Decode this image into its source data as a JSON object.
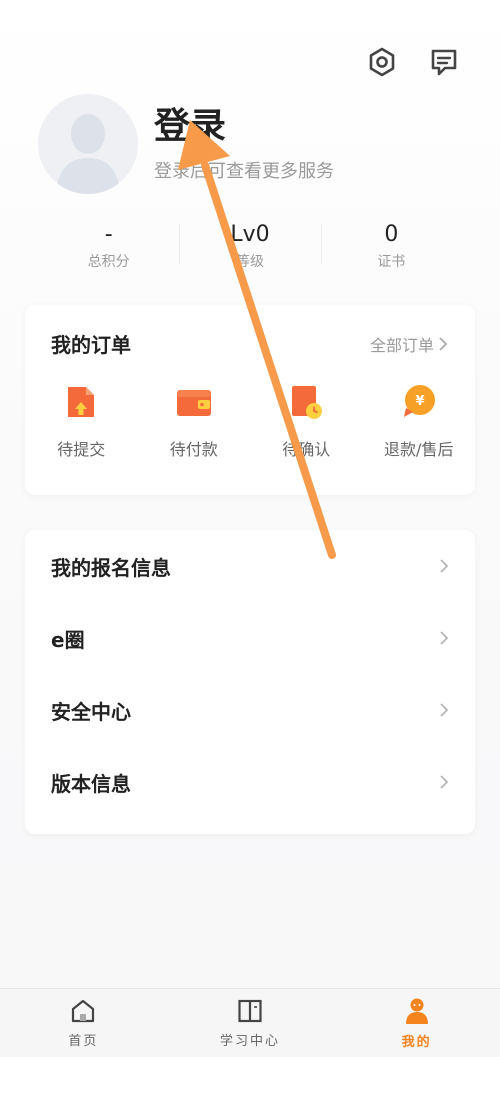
{
  "header": {
    "login_title": "登录",
    "login_subtitle": "登录后可查看更多服务"
  },
  "top_icons": [
    "settings-hexagon-icon",
    "message-icon"
  ],
  "stats": [
    {
      "value": "-",
      "label": "总积分"
    },
    {
      "value": "Lv0",
      "label": "等级"
    },
    {
      "value": "0",
      "label": "证书"
    }
  ],
  "orders": {
    "title": "我的订单",
    "all_label": "全部订单",
    "items": [
      {
        "label": "待提交",
        "icon": "document-upload-icon"
      },
      {
        "label": "待付款",
        "icon": "wallet-icon"
      },
      {
        "label": "待确认",
        "icon": "document-clock-icon"
      },
      {
        "label": "退款/售后",
        "icon": "yen-bubble-icon"
      }
    ]
  },
  "menu": [
    {
      "label": "我的报名信息"
    },
    {
      "label": "e圈"
    },
    {
      "label": "安全中心"
    },
    {
      "label": "版本信息"
    }
  ],
  "tabs": [
    {
      "label": "首页",
      "icon": "home-icon"
    },
    {
      "label": "学习中心",
      "icon": "book-icon"
    },
    {
      "label": "我的",
      "icon": "profile-icon"
    }
  ],
  "colors": {
    "accent": "#f5841f",
    "annotation_arrow": "#f79a4a"
  }
}
